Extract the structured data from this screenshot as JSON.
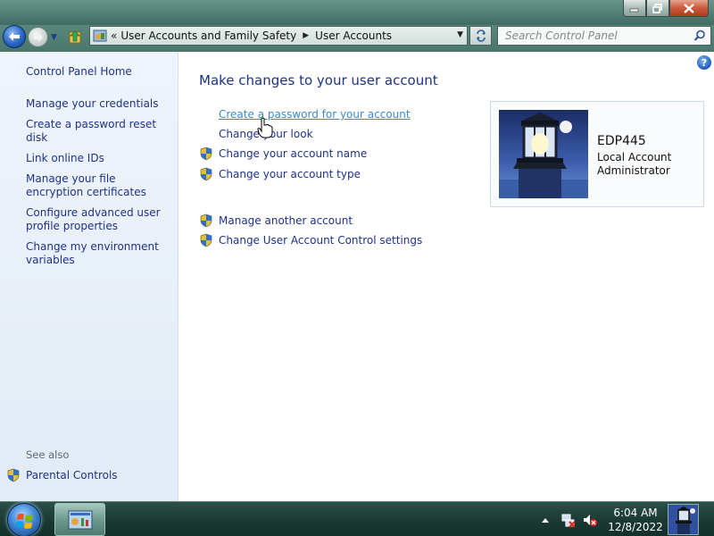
{
  "window": {
    "controls": [
      "minimize-icon",
      "maximize-icon",
      "close-icon"
    ]
  },
  "addressbar": {
    "overflow_chevron": "«",
    "breadcrumbs": [
      "User Accounts and Family Safety",
      "User Accounts"
    ],
    "search_placeholder": "Search Control Panel"
  },
  "sidebar": {
    "home": "Control Panel Home",
    "links": [
      "Manage your credentials",
      "Create a password reset disk",
      "Link online IDs",
      "Manage your file encryption certificates",
      "Configure advanced user profile properties",
      "Change my environment variables"
    ],
    "see_also": "See also",
    "parental_controls": "Parental Controls"
  },
  "main": {
    "title": "Make changes to your user account",
    "tasks": [
      "Create a password for your account",
      "Change your look",
      "Change your account name",
      "Change your account type",
      "Manage another account",
      "Change User Account Control settings"
    ],
    "account": {
      "name": "EDP445",
      "type": "Local Account",
      "role": "Administrator"
    },
    "help": "?"
  },
  "taskbar": {
    "time": "6:04 AM",
    "date": "12/8/2022"
  },
  "colors": {
    "link": "#1e3287",
    "link_hover": "#3c88d0",
    "sidebar_bg": "#e6eef8",
    "chrome": "#4f7d73"
  }
}
